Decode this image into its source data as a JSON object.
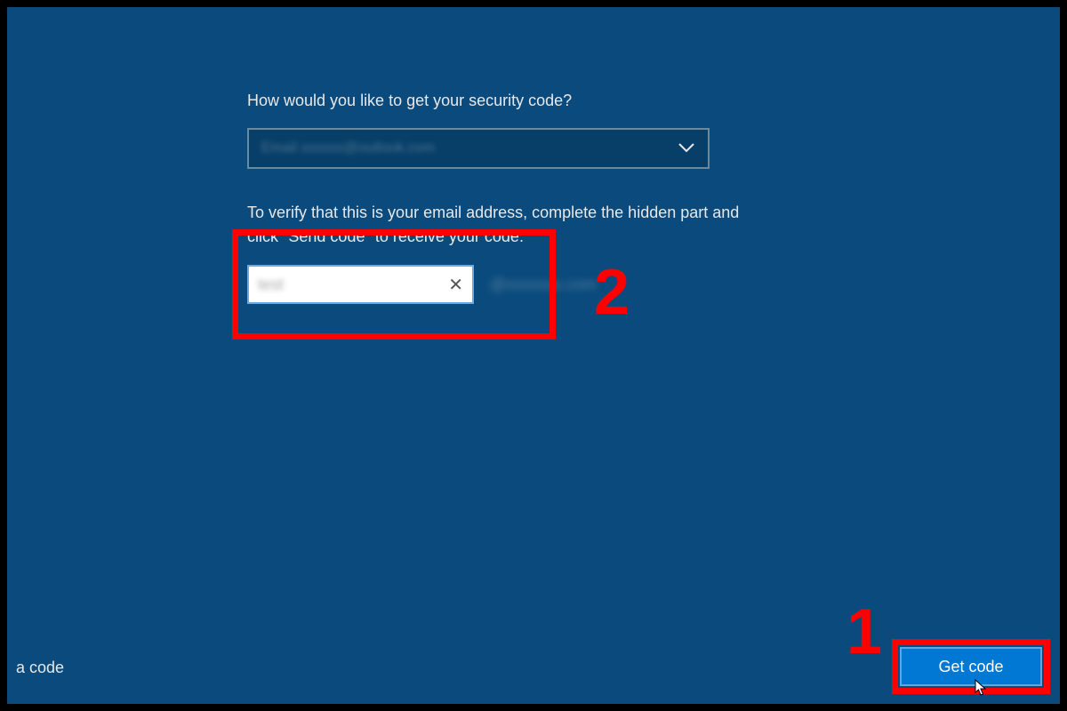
{
  "labels": {
    "security_code_prompt": "How would you like to get your security code?"
  },
  "dropdown": {
    "selected_blurred": "Email xxxxxx@outlook.com"
  },
  "verify": {
    "instruction": "To verify that this is your email address, complete the hidden part and click \"Send code\" to receive your code."
  },
  "input": {
    "value_blurred": "test",
    "domain_blurred": "@xxxxxxx.com"
  },
  "buttons": {
    "get_code": "Get code"
  },
  "bottom_left": {
    "partial_text": "a code"
  },
  "annotations": {
    "num1": "1",
    "num2": "2"
  },
  "colors": {
    "background": "#0a4a7c",
    "accent": "#0078d4",
    "highlight": "#ff0000"
  }
}
